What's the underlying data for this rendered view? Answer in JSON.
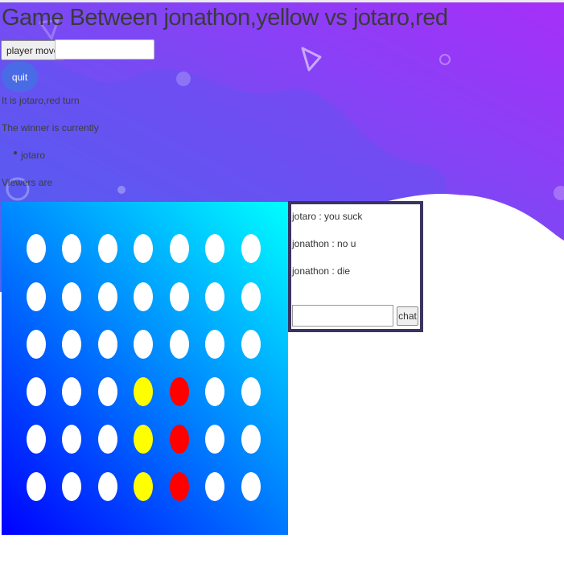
{
  "title": "Game Between jonathon,yellow vs jotaro,red",
  "controls": {
    "move_button_label": "player move",
    "move_input_value": "",
    "quit_button_label": "quit"
  },
  "status": {
    "turn_text": "It is jotaro,red turn",
    "winner_label": "The winner is currently",
    "winners": [
      "jotaro"
    ],
    "viewers_label": "Viewers are"
  },
  "board": {
    "columns": 7,
    "rows": 6,
    "cells": [
      [
        "empty",
        "empty",
        "empty",
        "empty",
        "empty",
        "empty",
        "empty"
      ],
      [
        "empty",
        "empty",
        "empty",
        "empty",
        "empty",
        "empty",
        "empty"
      ],
      [
        "empty",
        "empty",
        "empty",
        "empty",
        "empty",
        "empty",
        "empty"
      ],
      [
        "empty",
        "empty",
        "empty",
        "yellow",
        "red",
        "empty",
        "empty"
      ],
      [
        "empty",
        "empty",
        "empty",
        "yellow",
        "red",
        "empty",
        "empty"
      ],
      [
        "empty",
        "empty",
        "empty",
        "yellow",
        "red",
        "empty",
        "empty"
      ]
    ],
    "colors": {
      "empty": "#ffffff",
      "yellow": "#ffff00",
      "red": "#ff0000",
      "board_gradient_start": "#0000ff",
      "board_gradient_end": "#00ffff"
    }
  },
  "chat": {
    "messages": [
      "jotaro : you suck",
      "jonathon : no u",
      "jonathon : die"
    ],
    "input_value": "",
    "send_button_label": "chat"
  },
  "theme": {
    "hero_gradient_start": "#a233f8",
    "hero_gradient_end": "#4c5ff0",
    "quit_button_color": "#4a6be6",
    "chat_border_color": "#3a3560"
  }
}
